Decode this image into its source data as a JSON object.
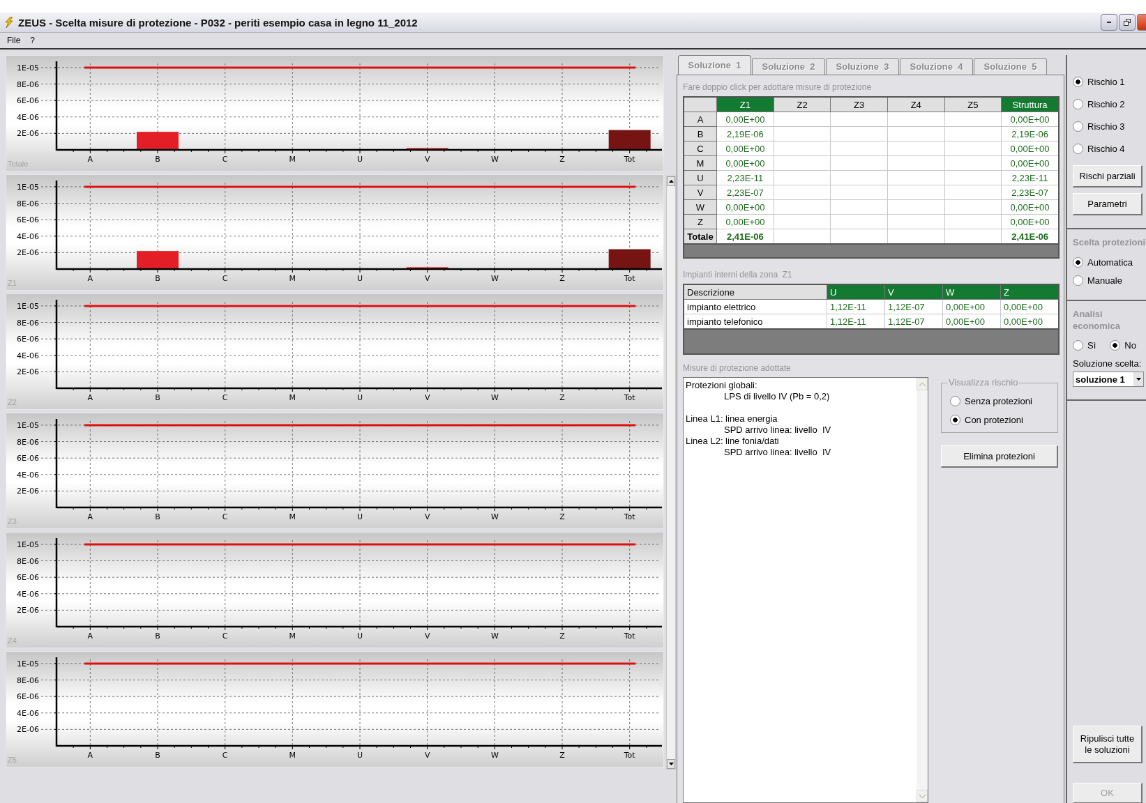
{
  "window": {
    "title": "ZEUS - Scelta misure di protezione - P032 -  periti esempio casa in legno 11_2012"
  },
  "menu": [
    "File",
    "?"
  ],
  "charts": [
    {
      "chart_data": {
        "type": "bar",
        "title": "Totale",
        "categories": [
          "A",
          "B",
          "C",
          "M",
          "U",
          "V",
          "W",
          "Z",
          "Tot"
        ],
        "grid": true,
        "ylim": [
          0,
          1.05e-05
        ],
        "yticks": [
          {
            "value": 2e-06,
            "label": "2E-06"
          },
          {
            "value": 4e-06,
            "label": "4E-06"
          },
          {
            "value": 6e-06,
            "label": "6E-06"
          },
          {
            "value": 8e-06,
            "label": "8E-06"
          },
          {
            "value": 1e-05,
            "label": "1E-05"
          }
        ],
        "series": [
          {
            "color": "#e41e26",
            "values": [
              0,
              2.19e-06,
              0,
              0,
              2.23e-11,
              2.23e-07,
              0,
              0,
              null
            ]
          },
          {
            "color": "#761414",
            "values": [
              null,
              null,
              null,
              null,
              null,
              null,
              null,
              null,
              2.41e-06
            ]
          }
        ],
        "ref_lines": [
          {
            "axis": "y",
            "value": 1e-05,
            "color": "#e01010"
          }
        ]
      }
    },
    {
      "chart_data": {
        "type": "bar",
        "title": "Z1",
        "categories": [
          "A",
          "B",
          "C",
          "M",
          "U",
          "V",
          "W",
          "Z",
          "Tot"
        ],
        "grid": true,
        "ylim": [
          0,
          1.05e-05
        ],
        "yticks": [
          {
            "value": 2e-06,
            "label": "2E-06"
          },
          {
            "value": 4e-06,
            "label": "4E-06"
          },
          {
            "value": 6e-06,
            "label": "6E-06"
          },
          {
            "value": 8e-06,
            "label": "8E-06"
          },
          {
            "value": 1e-05,
            "label": "1E-05"
          }
        ],
        "series": [
          {
            "color": "#e41e26",
            "values": [
              0,
              2.19e-06,
              0,
              0,
              2.23e-11,
              2.23e-07,
              0,
              0,
              null
            ]
          },
          {
            "color": "#761414",
            "values": [
              null,
              null,
              null,
              null,
              null,
              null,
              null,
              null,
              2.41e-06
            ]
          }
        ],
        "ref_lines": [
          {
            "axis": "y",
            "value": 1e-05,
            "color": "#e01010"
          }
        ]
      }
    },
    {
      "chart_data": {
        "type": "bar",
        "title": "Z2",
        "categories": [
          "A",
          "B",
          "C",
          "M",
          "U",
          "V",
          "W",
          "Z",
          "Tot"
        ],
        "grid": true,
        "ylim": [
          0,
          1.05e-05
        ],
        "yticks": [
          {
            "value": 2e-06,
            "label": "2E-06"
          },
          {
            "value": 4e-06,
            "label": "4E-06"
          },
          {
            "value": 6e-06,
            "label": "6E-06"
          },
          {
            "value": 8e-06,
            "label": "8E-06"
          },
          {
            "value": 1e-05,
            "label": "1E-05"
          }
        ],
        "series": [
          {
            "color": "#e41e26",
            "values": [
              0,
              0,
              0,
              0,
              0,
              0,
              0,
              0,
              null
            ]
          },
          {
            "color": "#761414",
            "values": [
              null,
              null,
              null,
              null,
              null,
              null,
              null,
              null,
              0
            ]
          }
        ],
        "ref_lines": [
          {
            "axis": "y",
            "value": 1e-05,
            "color": "#e01010"
          }
        ]
      }
    },
    {
      "chart_data": {
        "type": "bar",
        "title": "Z3",
        "categories": [
          "A",
          "B",
          "C",
          "M",
          "U",
          "V",
          "W",
          "Z",
          "Tot"
        ],
        "grid": true,
        "ylim": [
          0,
          1.05e-05
        ],
        "yticks": [
          {
            "value": 2e-06,
            "label": "2E-06"
          },
          {
            "value": 4e-06,
            "label": "4E-06"
          },
          {
            "value": 6e-06,
            "label": "6E-06"
          },
          {
            "value": 8e-06,
            "label": "8E-06"
          },
          {
            "value": 1e-05,
            "label": "1E-05"
          }
        ],
        "series": [
          {
            "color": "#e41e26",
            "values": [
              0,
              0,
              0,
              0,
              0,
              0,
              0,
              0,
              null
            ]
          },
          {
            "color": "#761414",
            "values": [
              null,
              null,
              null,
              null,
              null,
              null,
              null,
              null,
              0
            ]
          }
        ],
        "ref_lines": [
          {
            "axis": "y",
            "value": 1e-05,
            "color": "#e01010"
          }
        ]
      }
    },
    {
      "chart_data": {
        "type": "bar",
        "title": "Z4",
        "categories": [
          "A",
          "B",
          "C",
          "M",
          "U",
          "V",
          "W",
          "Z",
          "Tot"
        ],
        "grid": true,
        "ylim": [
          0,
          1.05e-05
        ],
        "yticks": [
          {
            "value": 2e-06,
            "label": "2E-06"
          },
          {
            "value": 4e-06,
            "label": "4E-06"
          },
          {
            "value": 6e-06,
            "label": "6E-06"
          },
          {
            "value": 8e-06,
            "label": "8E-06"
          },
          {
            "value": 1e-05,
            "label": "1E-05"
          }
        ],
        "series": [
          {
            "color": "#e41e26",
            "values": [
              0,
              0,
              0,
              0,
              0,
              0,
              0,
              0,
              null
            ]
          },
          {
            "color": "#761414",
            "values": [
              null,
              null,
              null,
              null,
              null,
              null,
              null,
              null,
              0
            ]
          }
        ],
        "ref_lines": [
          {
            "axis": "y",
            "value": 1e-05,
            "color": "#e01010"
          }
        ]
      }
    },
    {
      "chart_data": {
        "type": "bar",
        "title": "Z5",
        "categories": [
          "A",
          "B",
          "C",
          "M",
          "U",
          "V",
          "W",
          "Z",
          "Tot"
        ],
        "grid": true,
        "ylim": [
          0,
          1.05e-05
        ],
        "yticks": [
          {
            "value": 2e-06,
            "label": "2E-06"
          },
          {
            "value": 4e-06,
            "label": "4E-06"
          },
          {
            "value": 6e-06,
            "label": "6E-06"
          },
          {
            "value": 8e-06,
            "label": "8E-06"
          },
          {
            "value": 1e-05,
            "label": "1E-05"
          }
        ],
        "series": [
          {
            "color": "#e41e26",
            "values": [
              0,
              0,
              0,
              0,
              0,
              0,
              0,
              0,
              null
            ]
          },
          {
            "color": "#761414",
            "values": [
              null,
              null,
              null,
              null,
              null,
              null,
              null,
              null,
              0
            ]
          }
        ],
        "ref_lines": [
          {
            "axis": "y",
            "value": 1e-05,
            "color": "#e01010"
          }
        ]
      }
    }
  ],
  "tabs": [
    {
      "label": "Soluzione  1",
      "selected": true
    },
    {
      "label": "Soluzione  2",
      "selected": false
    },
    {
      "label": "Soluzione  3",
      "selected": false
    },
    {
      "label": "Soluzione  4",
      "selected": false
    },
    {
      "label": "Soluzione  5",
      "selected": false
    }
  ],
  "hint": "Fare doppio click per adottare misure di protezione",
  "risk_table": {
    "columns": [
      {
        "label": "Z1",
        "highlighted": true
      },
      {
        "label": "Z2",
        "highlighted": false
      },
      {
        "label": "Z3",
        "highlighted": false
      },
      {
        "label": "Z4",
        "highlighted": false
      },
      {
        "label": "Z5",
        "highlighted": false
      },
      {
        "label": "Struttura",
        "highlighted": true
      }
    ],
    "rows": [
      {
        "label": "A",
        "kind": "row",
        "cells": [
          "0,00E+00",
          null,
          null,
          null,
          null,
          "0,00E+00"
        ]
      },
      {
        "label": "B",
        "kind": "row",
        "cells": [
          "2,19E-06",
          null,
          null,
          null,
          null,
          "2,19E-06"
        ]
      },
      {
        "label": "C",
        "kind": "row",
        "cells": [
          "0,00E+00",
          null,
          null,
          null,
          null,
          "0,00E+00"
        ]
      },
      {
        "label": "M",
        "kind": "row",
        "cells": [
          "0,00E+00",
          null,
          null,
          null,
          null,
          "0,00E+00"
        ]
      },
      {
        "label": "U",
        "kind": "row",
        "cells": [
          "2,23E-11",
          null,
          null,
          null,
          null,
          "2,23E-11"
        ]
      },
      {
        "label": "V",
        "kind": "row",
        "cells": [
          "2,23E-07",
          null,
          null,
          null,
          null,
          "2,23E-07"
        ]
      },
      {
        "label": "W",
        "kind": "row",
        "cells": [
          "0,00E+00",
          null,
          null,
          null,
          null,
          "0,00E+00"
        ]
      },
      {
        "label": "Z",
        "kind": "row",
        "cells": [
          "0,00E+00",
          null,
          null,
          null,
          null,
          "0,00E+00"
        ]
      },
      {
        "label": "Totale",
        "kind": "total",
        "cells": [
          "2,41E-06",
          null,
          null,
          null,
          null,
          "2,41E-06"
        ]
      }
    ]
  },
  "plants_caption": "Impianti interni della zona  Z1",
  "plants_table": {
    "columns": [
      {
        "label": "Descrizione",
        "highlighted": false
      },
      {
        "label": "U",
        "highlighted": true
      },
      {
        "label": "V",
        "highlighted": true
      },
      {
        "label": "W",
        "highlighted": true
      },
      {
        "label": "Z",
        "highlighted": true
      }
    ],
    "rows": [
      {
        "cells": [
          "impianto elettrico",
          "1,12E-11",
          "1,12E-07",
          "0,00E+00",
          "0,00E+00"
        ]
      },
      {
        "cells": [
          "impianto telefonico",
          "1,12E-11",
          "1,12E-07",
          "0,00E+00",
          "0,00E+00"
        ]
      }
    ]
  },
  "measures_caption": "Misure di protezione adottate",
  "measures": [
    {
      "lines": [
        {
          "text": "Protezioni globali:",
          "kind": "heading"
        },
        {
          "text": "LPS di livello IV (Pb = 0,2)",
          "kind": "detail"
        }
      ]
    },
    {
      "lines": [
        {
          "text": "Linea L1: linea energia",
          "kind": "heading"
        },
        {
          "text": "SPD arrivo linea: livello  IV",
          "kind": "detail"
        },
        {
          "text": "Linea L2: line fonia/dati",
          "kind": "heading"
        },
        {
          "text": "SPD arrivo linea: livello  IV",
          "kind": "detail"
        }
      ]
    }
  ],
  "view_group": {
    "title": "Visualizza rischio",
    "options": [
      {
        "label": "Senza protezioni",
        "selected": false
      },
      {
        "label": "Con protezioni",
        "selected": true
      }
    ]
  },
  "remove_button": "Elimina protezioni",
  "risks": [
    {
      "label": "Rischio 1",
      "selected": true
    },
    {
      "label": "Rischio 2",
      "selected": false
    },
    {
      "label": "Rischio 3",
      "selected": false
    },
    {
      "label": "Rischio 4",
      "selected": false
    }
  ],
  "partial_button": "Rischi parziali",
  "params_button": "Parametri",
  "choice": {
    "title": "Scelta protezioni",
    "options": [
      {
        "label": "Automatica",
        "selected": true
      },
      {
        "label": "Manuale",
        "selected": false
      }
    ]
  },
  "economic": {
    "title": "Analisi economica",
    "options": [
      {
        "label": "Sì",
        "selected": false
      },
      {
        "label": "No",
        "selected": true
      }
    ]
  },
  "solution": {
    "label": "Soluzione scelta:",
    "value": "soluzione 1"
  },
  "clear_button": "Ripulisci tutte le soluzioni",
  "ok_button": {
    "label": "OK",
    "disabled": true
  }
}
